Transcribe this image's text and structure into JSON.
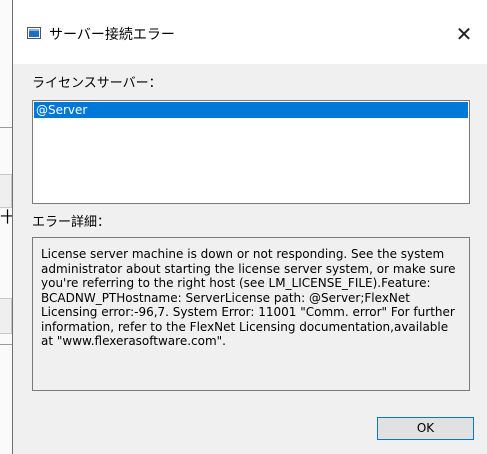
{
  "window": {
    "title": "サーバー接続エラー",
    "close_glyph": "✕"
  },
  "server_label": "ライセンスサーバー：",
  "server_list": {
    "items": [
      "@Server"
    ],
    "selected": "@Server"
  },
  "detail_label": "エラー詳細：",
  "error_detail": "License server machine is down or not responding. See the system administrator about starting the license server system, or make sure you're referring to the right host (see LM_LICENSE_FILE).Feature:        BCADNW_PTHostname: ServerLicense path:  @Server;FlexNet Licensing error:-96,7. System Error: 11001 \"Comm. error\" For further information, refer to the FlexNet Licensing documentation,available at \"www.flexerasoftware.com\".",
  "ok_button": "OK",
  "background_glyph": "十"
}
